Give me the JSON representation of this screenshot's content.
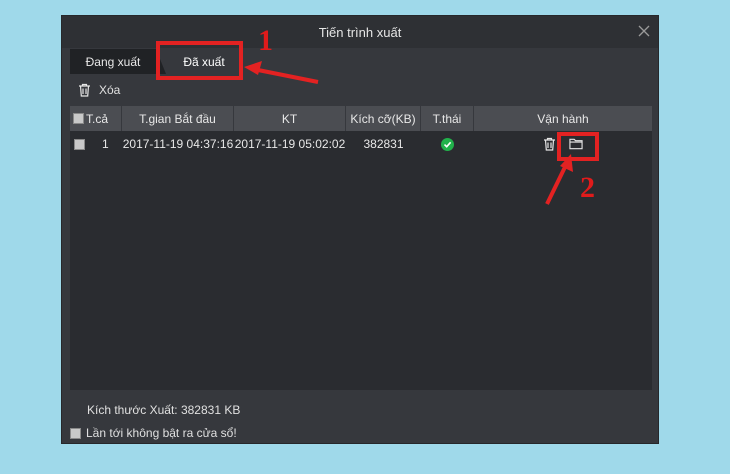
{
  "window": {
    "title": "Tiến trình xuất"
  },
  "tabs": [
    {
      "label": "Đang xuất"
    },
    {
      "label": "Đã xuất"
    }
  ],
  "toolbar": {
    "delete_label": "Xóa",
    "delete_icon": "trash-icon"
  },
  "table": {
    "headers": [
      "T.cả",
      "T.gian Bắt đầu",
      "KT",
      "Kích cỡ(KB)",
      "T.thái",
      "Vận hành"
    ],
    "rows": [
      {
        "index": "1",
        "start": "2017-11-19 04:37:16",
        "end": "2017-11-19 05:02:02",
        "size": "382831",
        "status": "complete",
        "actions": [
          "trash-icon",
          "folder-icon"
        ]
      }
    ]
  },
  "footer": {
    "export_size": "Kích thước Xuất: 382831 KB",
    "no_popup_label": "Lần tới không bật ra cửa sổ!"
  },
  "annotations": [
    {
      "label": "1"
    },
    {
      "label": "2"
    }
  ],
  "colors": {
    "page_background": "#9fd9ea",
    "dialog": "#36383d",
    "header": "#4b4d52",
    "status_ok": "#21b24b",
    "annotation": "#e32222"
  }
}
